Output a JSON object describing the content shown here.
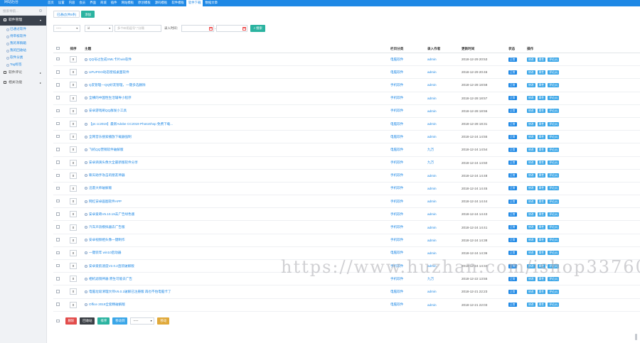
{
  "app": {
    "logo_text": "网站后台"
  },
  "topnav": [
    "首页",
    "设置",
    "内容",
    "会员",
    "界面",
    "商城",
    "插件",
    "网站模板",
    "原创模板",
    "源码模板",
    "软件模板",
    "软件下载",
    "数据文章"
  ],
  "topnav_active": 11,
  "sidebar": {
    "search_placeholder": "搜索导航...",
    "groups": [
      {
        "label": "软件管理",
        "active": true,
        "items": [
          "已通过软件",
          "待审核软件",
          "我的草稿箱",
          "我的回收站",
          "软件分类",
          "Tag标签"
        ]
      },
      {
        "label": "软件评论",
        "active": false,
        "items": []
      },
      {
        "label": "相关功能",
        "active": false,
        "items": []
      }
    ]
  },
  "tabs": [
    "已通过(共5条)",
    "添加"
  ],
  "tabs_active": 1,
  "filters": {
    "select1": "-----",
    "select2": "id",
    "keyword_placeholder": "多个ID用逗号\",\"分隔",
    "time_label": "录入时间：",
    "dash": "-",
    "search_button": "搜索"
  },
  "table": {
    "headers": {
      "sort": "排序",
      "title": "主题",
      "category": "栏目分类",
      "author": "录入作者",
      "time": "更新时间",
      "status": "状态",
      "ops": "操作"
    },
    "rows": [
      {
        "sort": "0",
        "title": "QQ号过生成XML卡片win软件",
        "category": "电脑软件",
        "author": "admin",
        "time": "2018-12-29 20:53"
      },
      {
        "sort": "0",
        "title": "UPUPOO动态壁纸桌面软件",
        "category": "电脑软件",
        "author": "admin",
        "time": "2018-12-29 20:46"
      },
      {
        "sort": "0",
        "title": "Q友管理—QQ好友管理，一键多选删除",
        "category": "手机软件",
        "author": "admin",
        "time": "2018-12-28 18:58"
      },
      {
        "sort": "0",
        "title": "全横的中国性生活辅导小程序",
        "category": "手机软件",
        "author": "admin",
        "time": "2018-12-28 18:57"
      },
      {
        "sort": "0",
        "title": "安卓游戏刷QQ群发小工具",
        "category": "手机软件",
        "author": "admin",
        "time": "2018-12-28 18:55"
      },
      {
        "sort": "0",
        "title": "【ps cc2019】最新Adobe CC2019 PhotoShop 免费下载...",
        "category": "电脑软件",
        "author": "admin",
        "time": "2018-12-28 18:31"
      },
      {
        "sort": "0",
        "title": "全网音乐搜索播放下载器强制",
        "category": "电脑软件",
        "author": "admin",
        "time": "2018-12-24 14:55"
      },
      {
        "sort": "0",
        "title": "飞机QQ营销软件破解版",
        "category": "电脑软件",
        "author": "九万",
        "time": "2018-12-24 14:54"
      },
      {
        "sort": "0",
        "title": "安卓滴滴头像大全最新版软件分享",
        "category": "手机软件",
        "author": "九万",
        "time": "2018-12-24 14:50"
      },
      {
        "sort": "0",
        "title": "聊天助手攻击的朋友神器",
        "category": "手机软件",
        "author": "admin",
        "time": "2018-12-24 14:48"
      },
      {
        "sort": "0",
        "title": "迅雷大师破解版",
        "category": "手机软件",
        "author": "admin",
        "time": "2018-12-24 14:45"
      },
      {
        "sort": "0",
        "title": "网红安卓画图软件APP",
        "category": "手机软件",
        "author": "admin",
        "time": "2018-12-24 14:44"
      },
      {
        "sort": "0",
        "title": "安卓爱奇V5.10.19去广告绿色版",
        "category": "手机软件",
        "author": "admin",
        "time": "2018-12-24 14:43"
      },
      {
        "sort": "0",
        "title": "汽车声浪模拟器去广告版",
        "category": "手机软件",
        "author": "admin",
        "time": "2018-12-24 14:41"
      },
      {
        "sort": "0",
        "title": "安卓视频相头像一键制作",
        "category": "手机软件",
        "author": "admin",
        "time": "2018-12-24 14:38"
      },
      {
        "sort": "0",
        "title": "一键装年 win10启动器",
        "category": "电脑软件",
        "author": "admin",
        "time": "2018-12-24 14:36"
      },
      {
        "sort": "0",
        "title": "安卓爱航速度V2.0.2直装破解版",
        "category": "手机软件",
        "author": "admin",
        "time": "2018-12-24 14:34"
      },
      {
        "sort": "0",
        "title": "相机滤镜神器 原生可能去广告",
        "category": "手机软件",
        "author": "九万",
        "time": "2018-12-22 13:55"
      },
      {
        "sort": "0",
        "title": "电脑垃圾清理大师V6.0.1破解已注册版 再也不怕电脑卡了",
        "category": "电脑软件",
        "author": "admin",
        "time": "2018-12-21 22:23"
      },
      {
        "sort": "0",
        "title": "Office 2019全套精破解版",
        "category": "电脑软件",
        "author": "admin",
        "time": "2018-12-21 22:03"
      }
    ],
    "status_label": "正常",
    "op_edit": "修改",
    "op_attr": "属性",
    "op_comment": "评论(0)"
  },
  "footer": {
    "delete": "删除",
    "recycle": "回收站",
    "sort": "排序",
    "modify": "移动到",
    "select": "-----",
    "gold": "移动"
  },
  "watermark": "https://www.huzhan.com/ishop33760",
  "colors": {
    "topbar": "#1e88e5",
    "accent_teal": "#2bb3a0",
    "link": "#1e88e5",
    "danger": "#e24c4b"
  }
}
